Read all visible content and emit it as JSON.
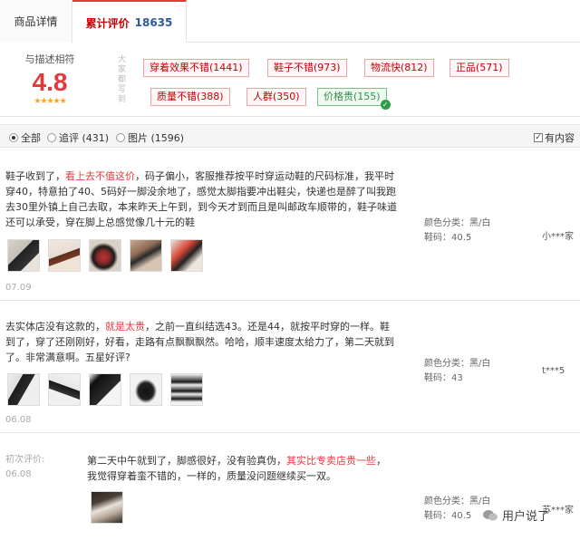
{
  "tabs": {
    "detail": "商品详情",
    "reviews": "累计评价",
    "review_count": "18635"
  },
  "summary": {
    "label": "与描述相符",
    "score": "4.8",
    "stars": "★★★★★",
    "vertical_label": "大家都写到",
    "tags": [
      {
        "text": "穿着效果不错(1441)"
      },
      {
        "text": "鞋子不错(973)"
      },
      {
        "text": "物流快(812)"
      },
      {
        "text": "正品(571)"
      },
      {
        "text": "质量不错(388)"
      },
      {
        "text": "人群(350)"
      },
      {
        "text": "价格贵(155)",
        "selected": true
      }
    ]
  },
  "filter": {
    "all": "全部",
    "followup": "追评 (431)",
    "images": "图片 (1596)",
    "has_content": "有内容"
  },
  "reviews": [
    {
      "text_before": "鞋子收到了，",
      "highlight": "看上去不值这价",
      "text_after": "，码子偏小，客服推荐按平时穿运动鞋的尺码标准，我平时穿40，特意拍了40、5码好一脚没余地了，感觉太脚指要冲出鞋尖，快递也是醉了叫我跑去30里外镇上自己去取，本来昨天上午到，到今天才到而且是叫邮政车顺带的，鞋子味道还可以承受，穿在脚上总感觉像几十元的鞋",
      "date": "07.09",
      "color": "颜色分类：黑/白",
      "size": "鞋码：40.5",
      "user": "小***家"
    },
    {
      "text_before": "去实体店没有这款的，",
      "highlight": "就是太贵",
      "text_after": "，之前一直纠结选43。还是44，就按平时穿的一样。鞋到了，穿了还刚刚好，好看，走路有点飘飘飘然。哈哈，顺丰速度太给力了，第二天就到了。非常满意啊。五星好评?",
      "date": "06.08",
      "color": "颜色分类：黑/白",
      "size": "鞋码：43",
      "user": "t***5"
    },
    {
      "first_label": "初次评价:",
      "text_before": "第二天中午就到了，脚感很好，没有验真伪，",
      "highlight": "其实比专卖店贵一些",
      "text_after": "，我觉得穿着蛮不错的，一样的，质量没问题继续买一双。",
      "date": "06.08",
      "color": "颜色分类：黑/白",
      "size": "鞋码：40.5",
      "user": "苏***家"
    }
  ],
  "watermark": "用户说了",
  "colors": {
    "accent": "#e4393c",
    "link": "#2a5b9a",
    "tag_border": "#e8a6a6",
    "selected_tag": "#3b8b4f"
  }
}
